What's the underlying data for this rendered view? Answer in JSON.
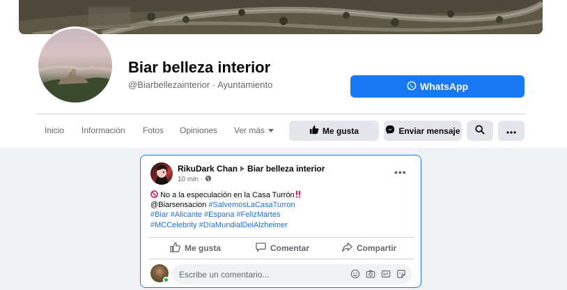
{
  "page": {
    "name": "Biar belleza interior",
    "handle": "@Biarbellezainterior · Ayuntamiento"
  },
  "header": {
    "whatsapp_label": "WhatsApp"
  },
  "tabs": [
    {
      "label": "Inicio"
    },
    {
      "label": "Información"
    },
    {
      "label": "Fotos"
    },
    {
      "label": "Opiniones"
    },
    {
      "label": "Ver más"
    }
  ],
  "actions": {
    "like_label": "Me gusta",
    "message_label": "Enviar mensaje"
  },
  "post": {
    "author": "RikuDark Chan",
    "target_page": "Biar belleza interior",
    "time": "10 min ·",
    "text_line1": "No a la especulación en la Casa Turrón",
    "mention": "@Biarsensacion",
    "tags_line2": "#SalvemosLaCasaTurron",
    "tags_line3": "#Biar #Alicante #Espana #FelizMartes",
    "tags_line4": "#MCCelebrity #DíaMundialDelAlzheimer",
    "like_label": "Me gusta",
    "comment_label": "Comentar",
    "share_label": "Compartir",
    "comment_placeholder": "Escribe un comentario..."
  },
  "colors": {
    "accent": "#1877f2",
    "hashtag": "#216fdb",
    "online": "#31a24c"
  }
}
